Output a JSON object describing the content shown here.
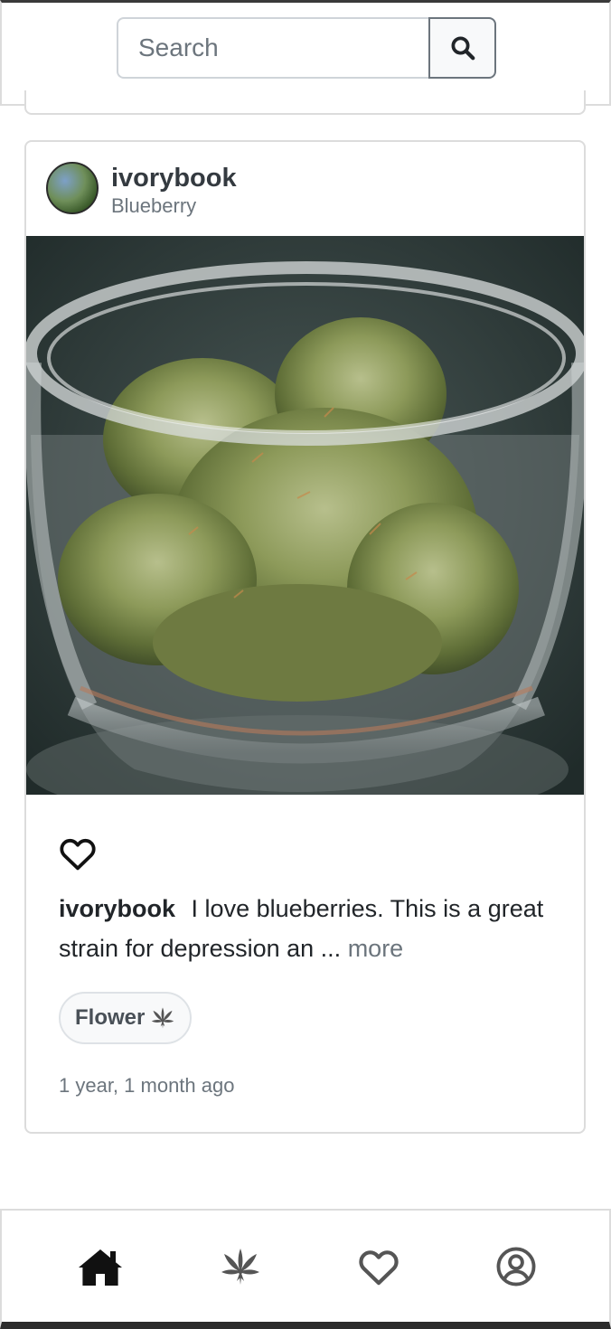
{
  "search": {
    "placeholder": "Search"
  },
  "post": {
    "username": "ivorybook",
    "strain": "Blueberry",
    "caption_user": "ivorybook",
    "caption_text": "I love blueberries. This is a great strain for depression an ...",
    "more_label": "more",
    "tag_label": "Flower",
    "timestamp": "1 year, 1 month ago",
    "liked": false
  },
  "icons": {
    "search": "search-icon",
    "like": "heart-outline-icon",
    "tag": "cannabis-leaf-icon",
    "nav_home": "home-icon",
    "nav_strains": "cannabis-leaf-icon",
    "nav_favorites": "heart-outline-icon",
    "nav_profile": "user-circle-icon"
  },
  "nav": {
    "active": "home"
  },
  "colors": {
    "text": "#212529",
    "muted": "#6c757d",
    "border": "#dcdcdc",
    "nav_active": "#212529",
    "nav_inactive": "#555555"
  }
}
